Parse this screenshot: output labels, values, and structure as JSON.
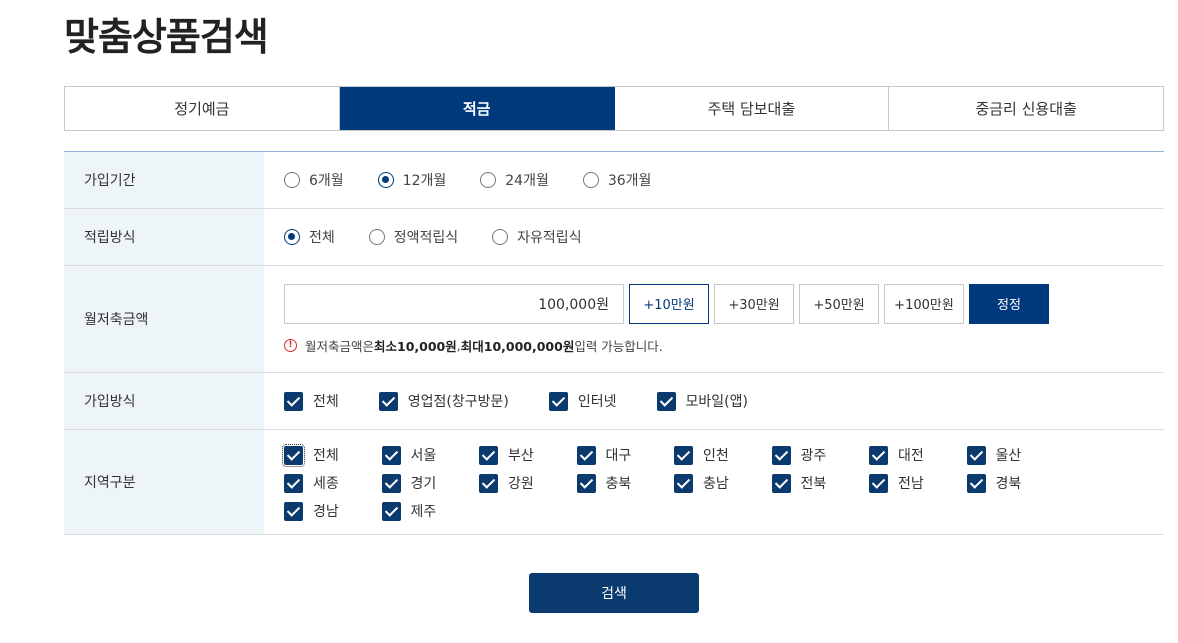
{
  "title": "맞춤상품검색",
  "tabs": [
    {
      "label": "정기예금",
      "active": false
    },
    {
      "label": "적금",
      "active": true
    },
    {
      "label": "주택 담보대출",
      "active": false
    },
    {
      "label": "중금리 신용대출",
      "active": false
    }
  ],
  "period": {
    "label": "가입기간",
    "options": [
      {
        "label": "6개월",
        "selected": false
      },
      {
        "label": "12개월",
        "selected": true
      },
      {
        "label": "24개월",
        "selected": false
      },
      {
        "label": "36개월",
        "selected": false
      }
    ]
  },
  "saving_method": {
    "label": "적립방식",
    "options": [
      {
        "label": "전체",
        "selected": true
      },
      {
        "label": "정액적립식",
        "selected": false
      },
      {
        "label": "자유적립식",
        "selected": false
      }
    ]
  },
  "amount": {
    "label": "월저축금액",
    "value": "100,000원",
    "buttons": [
      "+10만원",
      "+30만원",
      "+50만원",
      "+100만원"
    ],
    "reset_label": "정정",
    "note_prefix": "월저축금액은 ",
    "note_min": "최소10,000원",
    "note_sep": ", ",
    "note_max": "최대10,000,000원",
    "note_suffix": " 입력 가능합니다."
  },
  "join_method": {
    "label": "가입방식",
    "options": [
      {
        "label": "전체",
        "checked": true
      },
      {
        "label": "영업점(창구방문)",
        "checked": true
      },
      {
        "label": "인터넷",
        "checked": true
      },
      {
        "label": "모바일(앱)",
        "checked": true
      }
    ]
  },
  "region": {
    "label": "지역구분",
    "options": [
      {
        "label": "전체",
        "checked": true
      },
      {
        "label": "서울",
        "checked": true
      },
      {
        "label": "부산",
        "checked": true
      },
      {
        "label": "대구",
        "checked": true
      },
      {
        "label": "인천",
        "checked": true
      },
      {
        "label": "광주",
        "checked": true
      },
      {
        "label": "대전",
        "checked": true
      },
      {
        "label": "울산",
        "checked": true
      },
      {
        "label": "세종",
        "checked": true
      },
      {
        "label": "경기",
        "checked": true
      },
      {
        "label": "강원",
        "checked": true
      },
      {
        "label": "충북",
        "checked": true
      },
      {
        "label": "충남",
        "checked": true
      },
      {
        "label": "전북",
        "checked": true
      },
      {
        "label": "전남",
        "checked": true
      },
      {
        "label": "경북",
        "checked": true
      },
      {
        "label": "경남",
        "checked": true
      },
      {
        "label": "제주",
        "checked": true
      }
    ]
  },
  "search_label": "검색",
  "icons": {
    "info": "info-icon"
  },
  "colors": {
    "primary": "#003a7d",
    "checkbox": "#0b3a6e",
    "label_bg": "#eef5f9",
    "warning": "#d62c2c"
  }
}
